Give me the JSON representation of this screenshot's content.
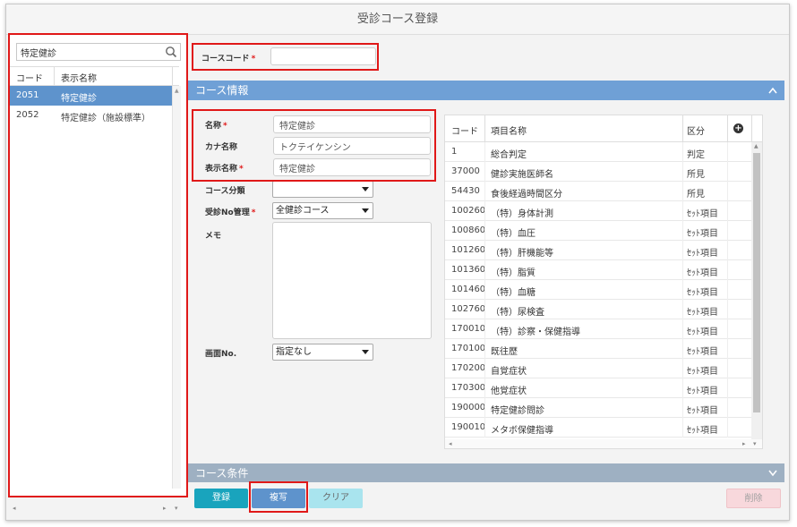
{
  "window": {
    "title": "受診コース登録"
  },
  "left_panel": {
    "search_value": "特定健診",
    "columns": {
      "code": "コード",
      "name": "表示名称"
    },
    "rows": [
      {
        "code": "2051",
        "name": "特定健診",
        "selected": true
      },
      {
        "code": "2052",
        "name": "特定健診（施設標準）",
        "selected": false
      }
    ]
  },
  "course_code": {
    "label": "コースコード",
    "required_mark": "*",
    "value": ""
  },
  "section_info": {
    "title": "コース情報",
    "collapse_glyph": "⌃"
  },
  "form": {
    "name": {
      "label": "名称",
      "required_mark": "*",
      "value": "特定健診"
    },
    "kana": {
      "label": "カナ名称",
      "value": "トクテイケンシン"
    },
    "display_name": {
      "label": "表示名称",
      "required_mark": "*",
      "value": "特定健診"
    },
    "course_class": {
      "label": "コース分類",
      "value": ""
    },
    "no_management": {
      "label": "受診No管理",
      "required_mark": "*",
      "value": "全健診コース"
    },
    "memo": {
      "label": "メモ",
      "value": ""
    },
    "screen_no": {
      "label": "画面No.",
      "value": "指定なし"
    }
  },
  "items_table": {
    "columns": {
      "code": "コード",
      "name": "項目名称",
      "kbn": "区分"
    },
    "rows": [
      {
        "code": "1",
        "name": "総合判定",
        "kbn": "判定"
      },
      {
        "code": "37000",
        "name": "健診実施医師名",
        "kbn": "所見"
      },
      {
        "code": "54430",
        "name": "食後経過時間区分",
        "kbn": "所見"
      },
      {
        "code": "100260",
        "name": "（特）身体計測",
        "kbn": "ｾｯﾄ項目"
      },
      {
        "code": "100860",
        "name": "（特）血圧",
        "kbn": "ｾｯﾄ項目"
      },
      {
        "code": "101260",
        "name": "（特）肝機能等",
        "kbn": "ｾｯﾄ項目"
      },
      {
        "code": "101360",
        "name": "（特）脂質",
        "kbn": "ｾｯﾄ項目"
      },
      {
        "code": "101460",
        "name": "（特）血糖",
        "kbn": "ｾｯﾄ項目"
      },
      {
        "code": "102760",
        "name": "（特）尿検査",
        "kbn": "ｾｯﾄ項目"
      },
      {
        "code": "170010",
        "name": "（特）診察・保健指導",
        "kbn": "ｾｯﾄ項目"
      },
      {
        "code": "170100",
        "name": "既往歴",
        "kbn": "ｾｯﾄ項目"
      },
      {
        "code": "170200",
        "name": "自覚症状",
        "kbn": "ｾｯﾄ項目"
      },
      {
        "code": "170300",
        "name": "他覚症状",
        "kbn": "ｾｯﾄ項目"
      },
      {
        "code": "190000",
        "name": "特定健診問診",
        "kbn": "ｾｯﾄ項目"
      },
      {
        "code": "190010",
        "name": "メタボ保健指導",
        "kbn": "ｾｯﾄ項目"
      }
    ]
  },
  "section_conditions": {
    "title": "コース条件",
    "expand_glyph": "⌄"
  },
  "buttons": {
    "register": "登録",
    "copy": "複写",
    "clear": "クリア",
    "delete": "削除"
  },
  "colors": {
    "accent": "#5e93cc",
    "section_bar": "#6fa0d6",
    "section_bar_collapsed": "#9eb0c2",
    "highlight_box": "#e01818"
  }
}
